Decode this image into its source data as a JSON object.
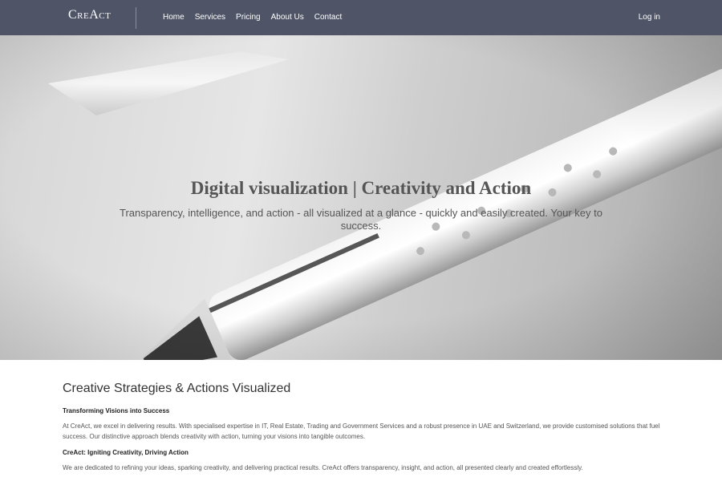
{
  "nav": {
    "logo": "CreAct",
    "links": [
      "Home",
      "Services",
      "Pricing",
      "About Us",
      "Contact"
    ],
    "login": "Log in"
  },
  "hero": {
    "title": "Digital visualization | Creativity and Action",
    "subtitle": "Transparency, intelligence, and action - all visualized at a glance - quickly and easily created. Your key to success."
  },
  "content": {
    "section_title": "Creative Strategies & Actions Visualized",
    "heading_1": "Transforming Visions into Success",
    "paragraph_1": "At CreAct, we excel in delivering results. With specialised expertise in IT, Real Estate, Trading and Government Services and a robust presence in UAE and Switzerland, we provide customised solutions that fuel success. Our distinctive approach blends creativity with action, turning your visions into tangible outcomes.",
    "heading_2": "CreAct: Igniting Creativity, Driving Action",
    "paragraph_2": "We are dedicated to refining your ideas, sparking creativity, and delivering practical results. CreAct offers transparency, insight, and action, all presented clearly and created effortlessly."
  }
}
